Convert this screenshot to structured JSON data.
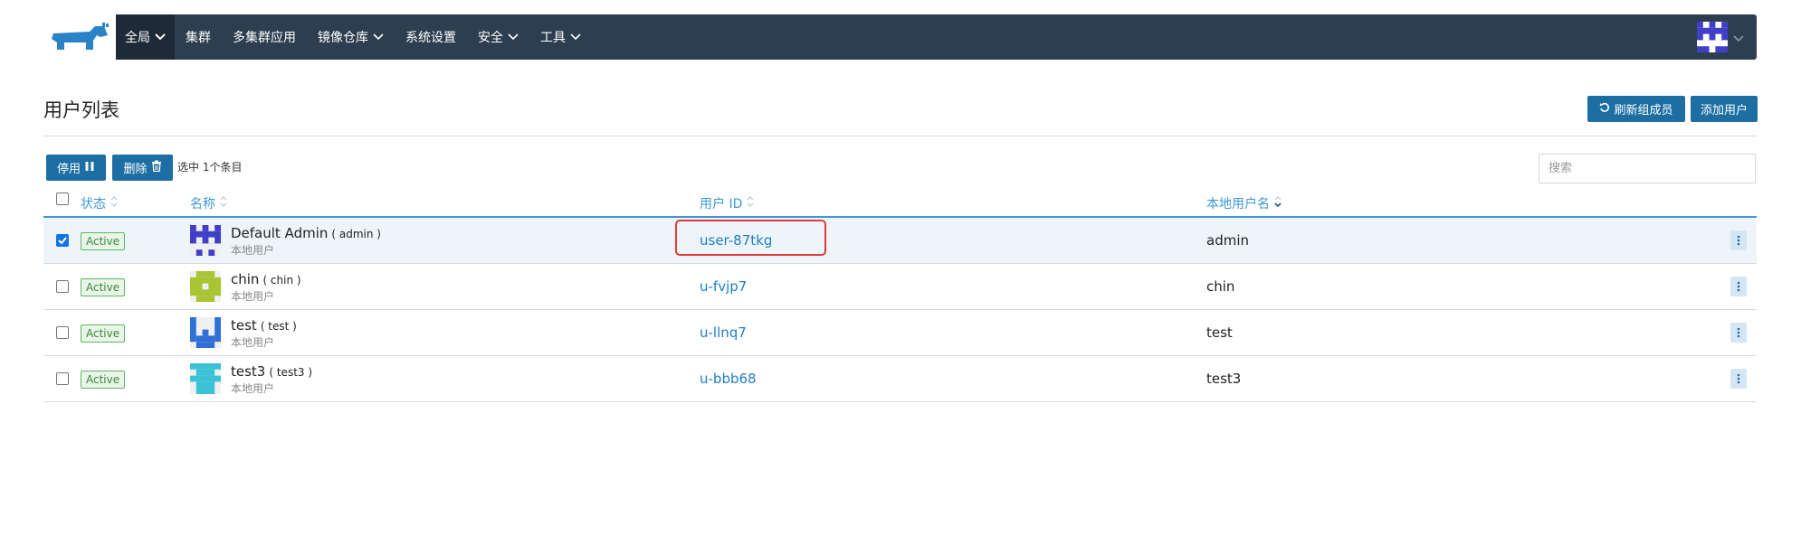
{
  "nav": {
    "items": [
      {
        "label": "全局",
        "has_dropdown": true,
        "active": true
      },
      {
        "label": "集群",
        "has_dropdown": false
      },
      {
        "label": "多集群应用",
        "has_dropdown": false
      },
      {
        "label": "镜像仓库",
        "has_dropdown": true
      },
      {
        "label": "系统设置",
        "has_dropdown": false
      },
      {
        "label": "安全",
        "has_dropdown": true
      },
      {
        "label": "工具",
        "has_dropdown": true
      }
    ],
    "brand_color": "#2c3e50"
  },
  "page": {
    "title": "用户列表",
    "refresh_button": "刷新组成员",
    "add_button": "添加用户"
  },
  "bulk": {
    "disable_button": "停用",
    "delete_button": "删除",
    "selected_label": "选中 1个条目",
    "search_placeholder": "搜索"
  },
  "table": {
    "headers": {
      "state": "状态",
      "name": "名称",
      "user_id": "用户 ID",
      "username": "本地用户名"
    },
    "rows": [
      {
        "checked": true,
        "state": "Active",
        "name": "Default Admin",
        "login": "( admin )",
        "type": "本地用户",
        "user_id": "user-87tkg",
        "username": "admin",
        "avatar_color": "#3f3fc8"
      },
      {
        "checked": false,
        "state": "Active",
        "name": "chin",
        "login": "( chin )",
        "type": "本地用户",
        "user_id": "u-fvjp7",
        "username": "chin",
        "avatar_color": "#a9c534"
      },
      {
        "checked": false,
        "state": "Active",
        "name": "test",
        "login": "( test )",
        "type": "本地用户",
        "user_id": "u-llnq7",
        "username": "test",
        "avatar_color": "#2f6fd6"
      },
      {
        "checked": false,
        "state": "Active",
        "name": "test3",
        "login": "( test3 )",
        "type": "本地用户",
        "user_id": "u-bbb68",
        "username": "test3",
        "avatar_color": "#3cc2d6"
      }
    ]
  }
}
